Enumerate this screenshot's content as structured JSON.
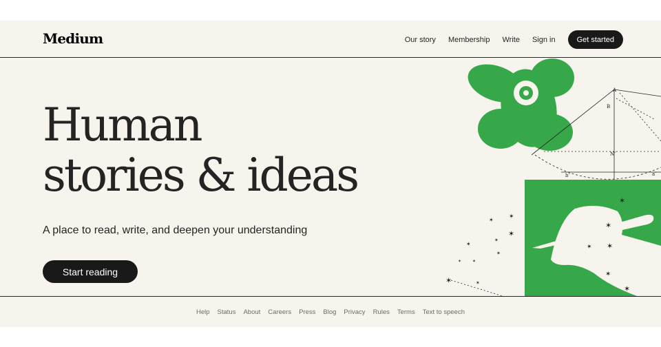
{
  "header": {
    "logo": "Medium",
    "nav": [
      {
        "label": "Our story"
      },
      {
        "label": "Membership"
      },
      {
        "label": "Write"
      },
      {
        "label": "Sign in"
      }
    ],
    "cta": "Get started"
  },
  "hero": {
    "headline_line1": "Human",
    "headline_line2": "stories & ideas",
    "subheading": "A place to read, write, and deepen your understanding",
    "cta": "Start reading"
  },
  "illustration": {
    "name": "hand-writing-flower-geometry-illustration",
    "colors": {
      "green": "#37a84a",
      "background": "#f7f4ed",
      "ink": "#242424"
    }
  },
  "footer": {
    "links": [
      {
        "label": "Help"
      },
      {
        "label": "Status"
      },
      {
        "label": "About"
      },
      {
        "label": "Careers"
      },
      {
        "label": "Press"
      },
      {
        "label": "Blog"
      },
      {
        "label": "Privacy"
      },
      {
        "label": "Rules"
      },
      {
        "label": "Terms"
      },
      {
        "label": "Text to speech"
      }
    ]
  },
  "colors": {
    "page_background": "#f7f4ed",
    "button_dark": "#191919",
    "text": "#242424",
    "footer_text": "#6b6b6b"
  }
}
